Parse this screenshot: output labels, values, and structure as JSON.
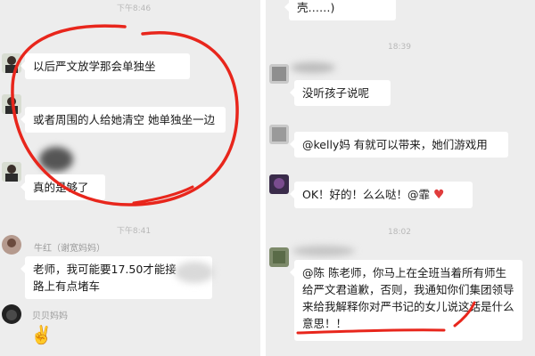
{
  "left": {
    "top_time": "下午8:46",
    "msg1": "以后严文放学那会单独坐",
    "msg2": "或者周围的人给她清空 她单独坐一边",
    "msg3": "真的是够了",
    "mid_time": "下午8:41",
    "sender1": "牛红（谢宽妈妈）",
    "msg4": "老师，我可能要17.50才能接",
    "msg4b": "路上有点堵车",
    "sender2": "贝贝妈妈",
    "emoji": "✌️"
  },
  "right": {
    "top_snippet": "壳……)",
    "time1": "18:39",
    "msg1": "没听孩子说呢",
    "msg2": "@kelly妈 有就可以带来，她们游戏用",
    "msg3": "OK！好的！么么哒！@霏",
    "heart": "♥",
    "time2": "18:02",
    "msg4": "@陈 陈老师，你马上在全班当着所有师生给严文君道歉，否则，我通知你们集团领导来给我解释你对严书记的女儿说这话是什么意思！！"
  },
  "colors": {
    "background": "#ededed",
    "bubble": "#ffffff",
    "annotation_red": "#e8261c"
  }
}
